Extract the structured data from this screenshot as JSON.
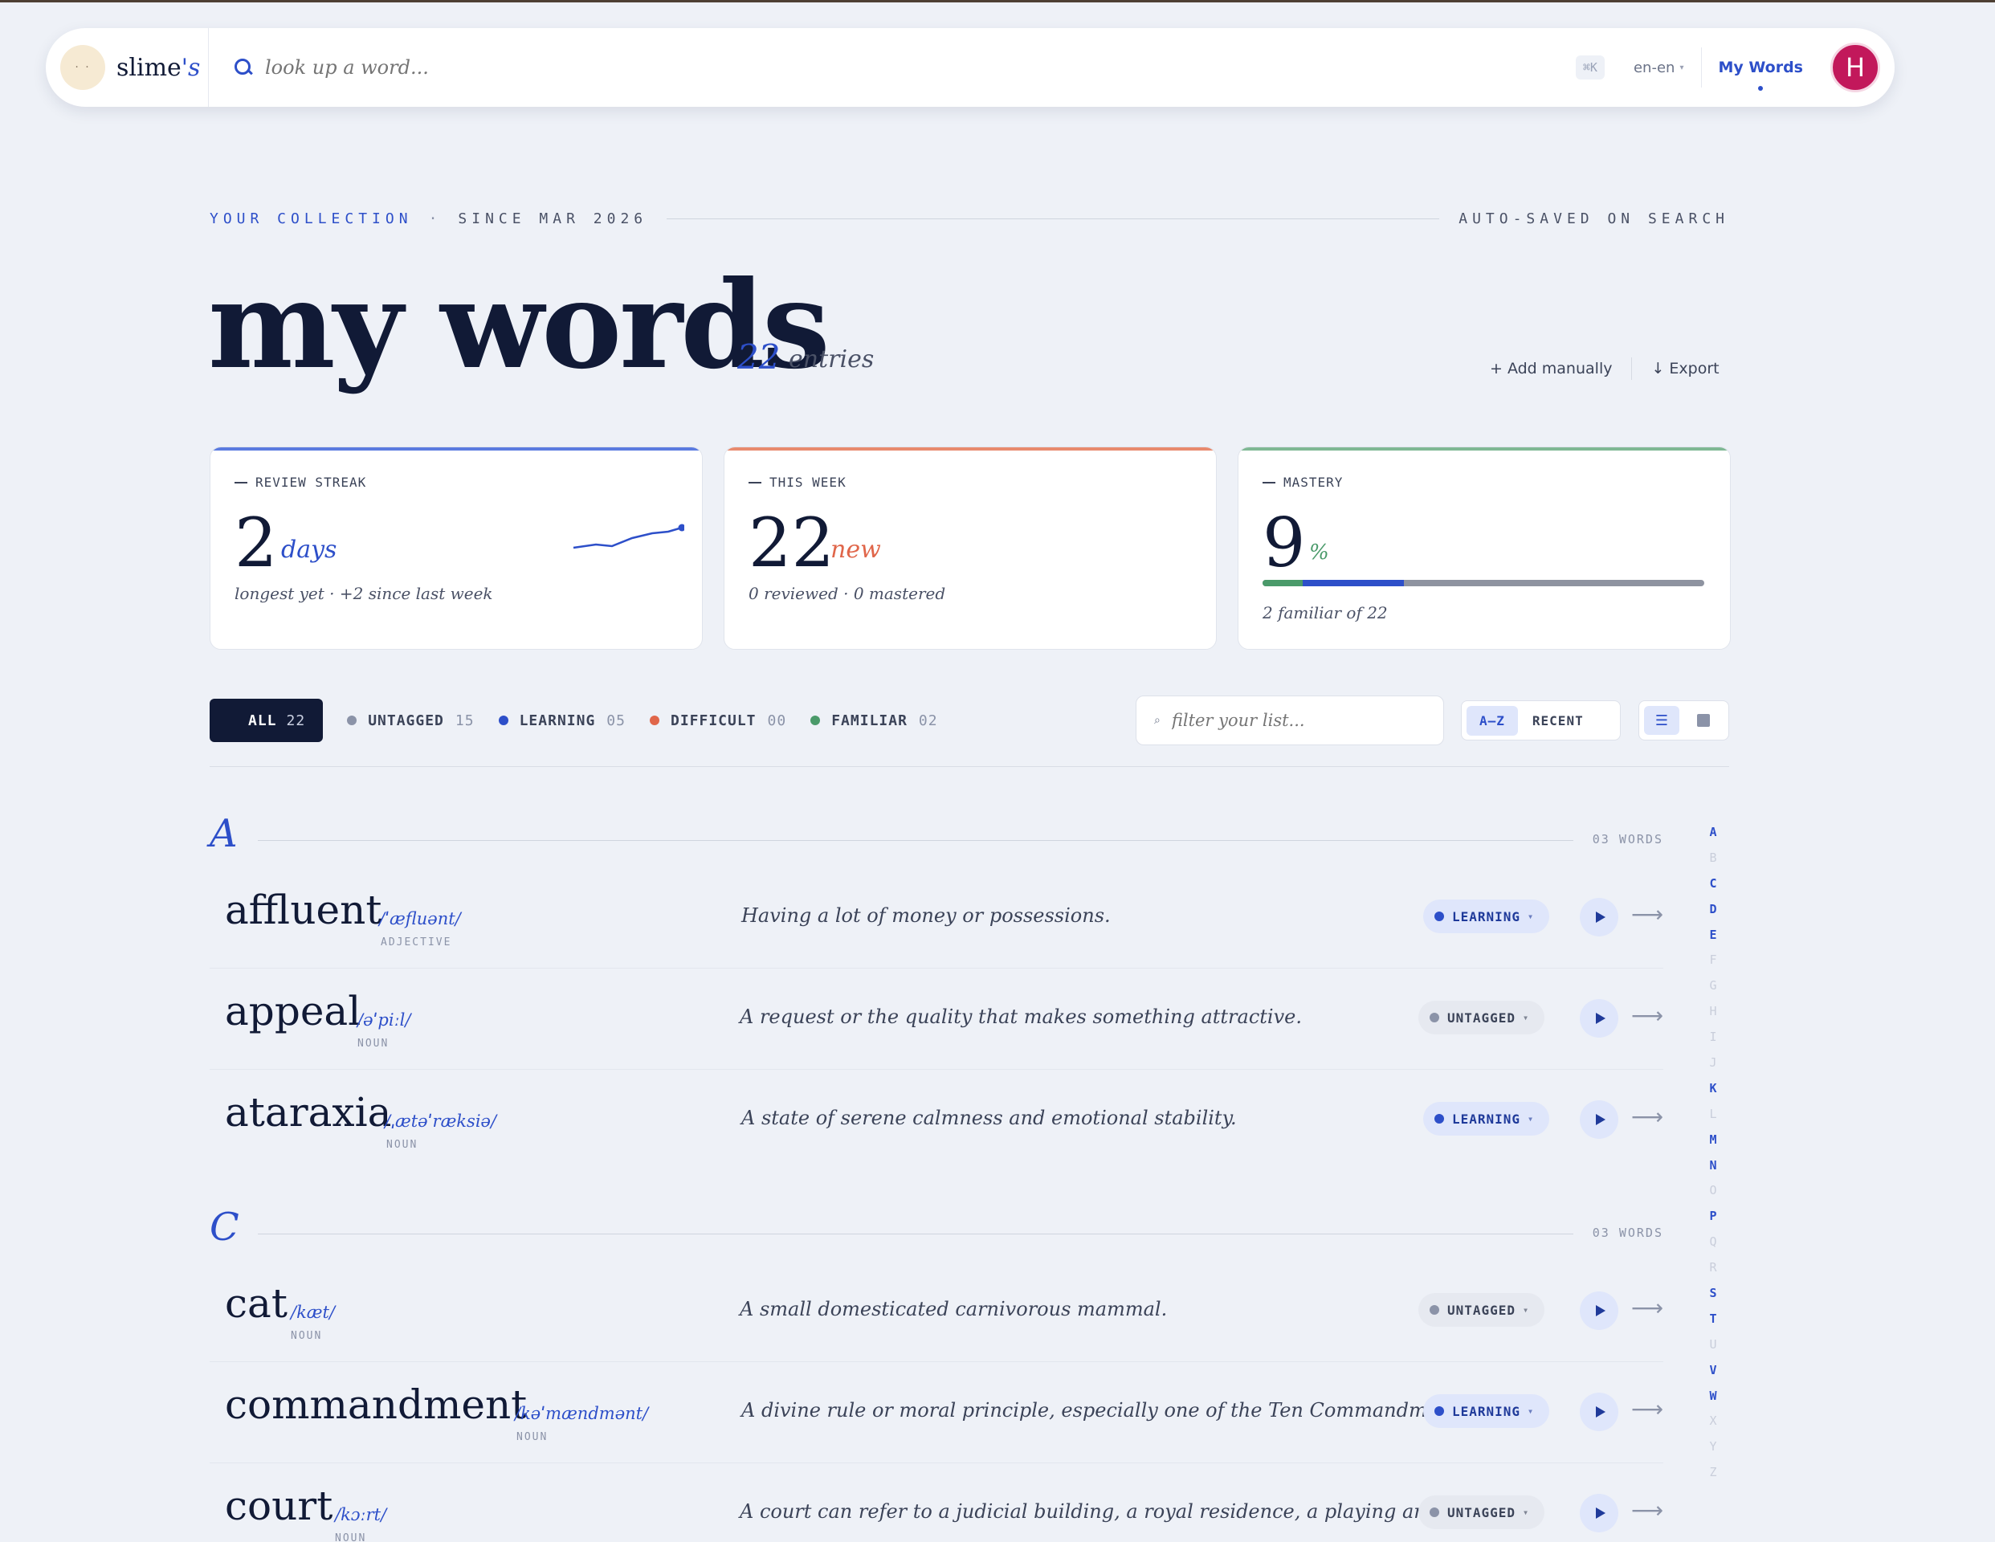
{
  "topbar": {
    "brand_main": "slime",
    "brand_suffix": "'s",
    "search_placeholder": "look up a word...",
    "shortcut": "⌘K",
    "language": "en-en",
    "nav_link": "My Words",
    "avatar_initial": "H"
  },
  "header": {
    "kicker": "YOUR COLLECTION",
    "separator": "·",
    "since": "SINCE MAR 2026",
    "autosave": "AUTO-SAVED ON SEARCH",
    "title": "my words",
    "count": "22",
    "count_label": "entries",
    "add_label": "+ Add manually",
    "export_label": "↓ Export"
  },
  "stats": {
    "streak": {
      "label": "REVIEW STREAK",
      "value": "2",
      "unit": "days",
      "note": "longest yet · +2 since last week",
      "accent": "#2d4fc9"
    },
    "week": {
      "label": "THIS WEEK",
      "value": "22",
      "unit": "new",
      "note": "0 reviewed · 0 mastered",
      "accent": "#e0664a"
    },
    "mastery": {
      "label": "MASTERY",
      "value": "9",
      "unit": "%",
      "note": "2 familiar of 22",
      "familiar_fraction": 0.09,
      "learning_fraction": 0.23,
      "accent": "#4a9a6a"
    }
  },
  "filters": {
    "all": {
      "label": "ALL",
      "count": "22"
    },
    "untagged": {
      "label": "UNTAGGED",
      "count": "15"
    },
    "learning": {
      "label": "LEARNING",
      "count": "05"
    },
    "difficult": {
      "label": "DIFFICULT",
      "count": "00"
    },
    "familiar": {
      "label": "FAMILIAR",
      "count": "02"
    },
    "search_placeholder": "filter your list...",
    "sort_az": "A–Z",
    "sort_recent": "RECENT"
  },
  "sections": [
    {
      "letter": "A",
      "count": "03 WORDS",
      "words": [
        {
          "word": "affluent",
          "ipa": "/ˈæfluənt/",
          "pos": "ADJECTIVE",
          "def": "Having a lot of money or possessions.",
          "tag": "LEARNING"
        },
        {
          "word": "appeal",
          "ipa": "/əˈpiːl/",
          "pos": "NOUN",
          "def": "A request or the quality that makes something attractive.",
          "tag": "UNTAGGED"
        },
        {
          "word": "ataraxia",
          "ipa": "/ˌætəˈræksiə/",
          "pos": "NOUN",
          "def": "A state of serene calmness and emotional stability.",
          "tag": "LEARNING"
        }
      ]
    },
    {
      "letter": "C",
      "count": "03 WORDS",
      "words": [
        {
          "word": "cat",
          "ipa": "/kæt/",
          "pos": "NOUN",
          "def": "A small domesticated carnivorous mammal.",
          "tag": "UNTAGGED"
        },
        {
          "word": "commandment",
          "ipa": "/kəˈmændmənt/",
          "pos": "NOUN",
          "def": "A divine rule or moral principle, especially one of the Ten Commandments.",
          "tag": "LEARNING"
        },
        {
          "word": "court",
          "ipa": "/kɔːrt/",
          "pos": "NOUN",
          "def": "A court can refer to a judicial building, a royal residence, a playing area for ...",
          "tag": "UNTAGGED"
        }
      ]
    }
  ],
  "alphabet": [
    "A",
    "B",
    "C",
    "D",
    "E",
    "F",
    "G",
    "H",
    "I",
    "J",
    "K",
    "L",
    "M",
    "N",
    "O",
    "P",
    "Q",
    "R",
    "S",
    "T",
    "U",
    "V",
    "W",
    "X",
    "Y",
    "Z"
  ],
  "alphabet_active": [
    "A",
    "C",
    "D",
    "E",
    "K",
    "M",
    "N",
    "P",
    "S",
    "T",
    "V",
    "W"
  ]
}
